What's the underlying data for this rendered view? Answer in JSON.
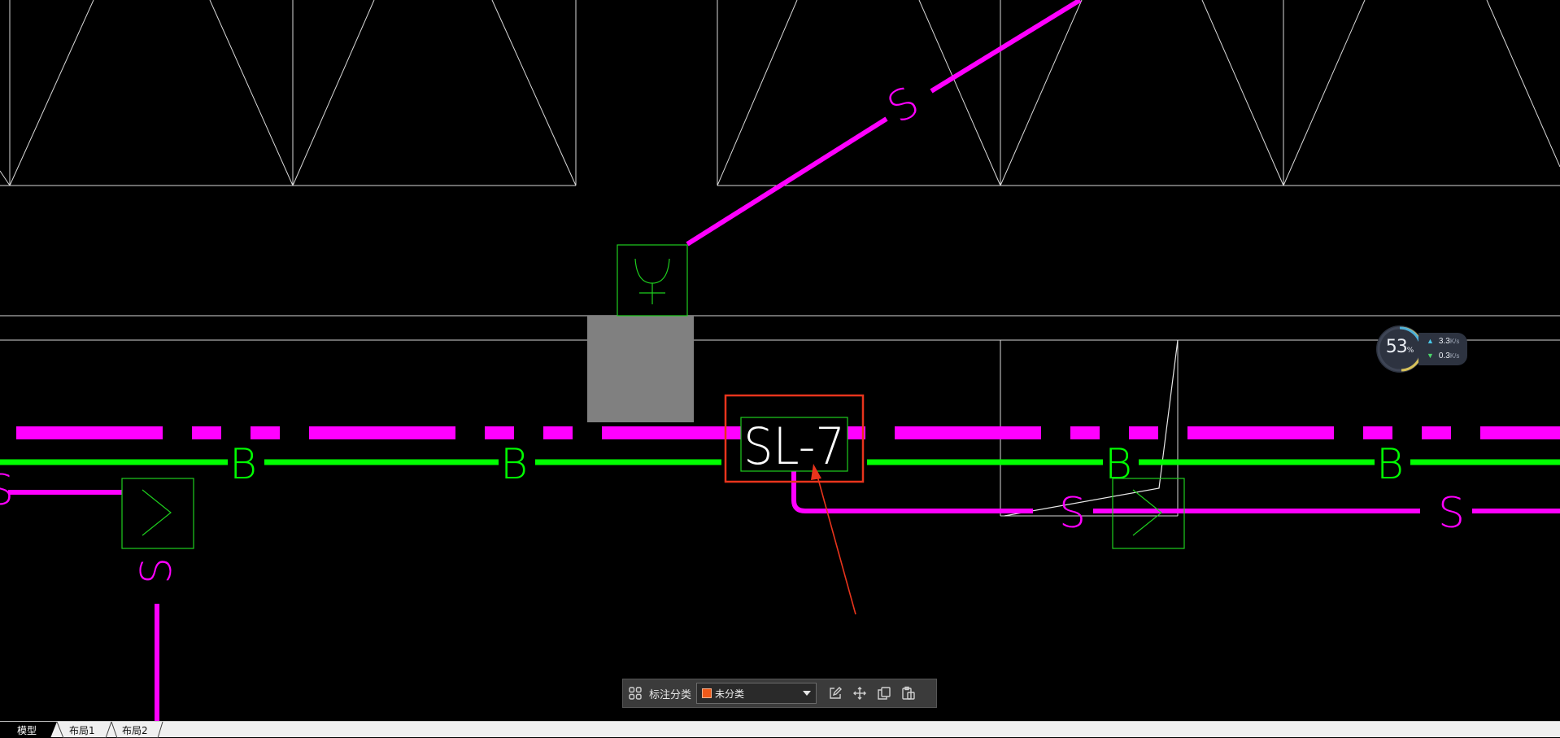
{
  "drawing": {
    "pipe_label": "S",
    "beam_label": "B",
    "tagged_pipe_label": "SL-7",
    "colors": {
      "background": "#000000",
      "pipe_magenta": "#ff00ff",
      "beam_green": "#00ff00",
      "equipment_green": "#1ecf1e",
      "structure_white": "#ffffff",
      "column_gray": "#808080",
      "annotation_red": "#e8341c"
    }
  },
  "net_widget": {
    "cpu_percent": "53",
    "percent_sign": "%",
    "upload_rate": "3.3",
    "download_rate": "0.3",
    "unit": "K/s",
    "gauge_level": 0.53
  },
  "anno_toolbar": {
    "category_label": "标注分类",
    "selected_category": "未分类",
    "swatch_color": "#ef5a1a",
    "icons": [
      "layout-grid-icon",
      "edit-icon",
      "move-icon",
      "copy-icon",
      "paste-icon"
    ]
  },
  "tabs": [
    {
      "label": "模型",
      "active": true
    },
    {
      "label": "布局1",
      "active": false
    },
    {
      "label": "布局2",
      "active": false
    }
  ]
}
